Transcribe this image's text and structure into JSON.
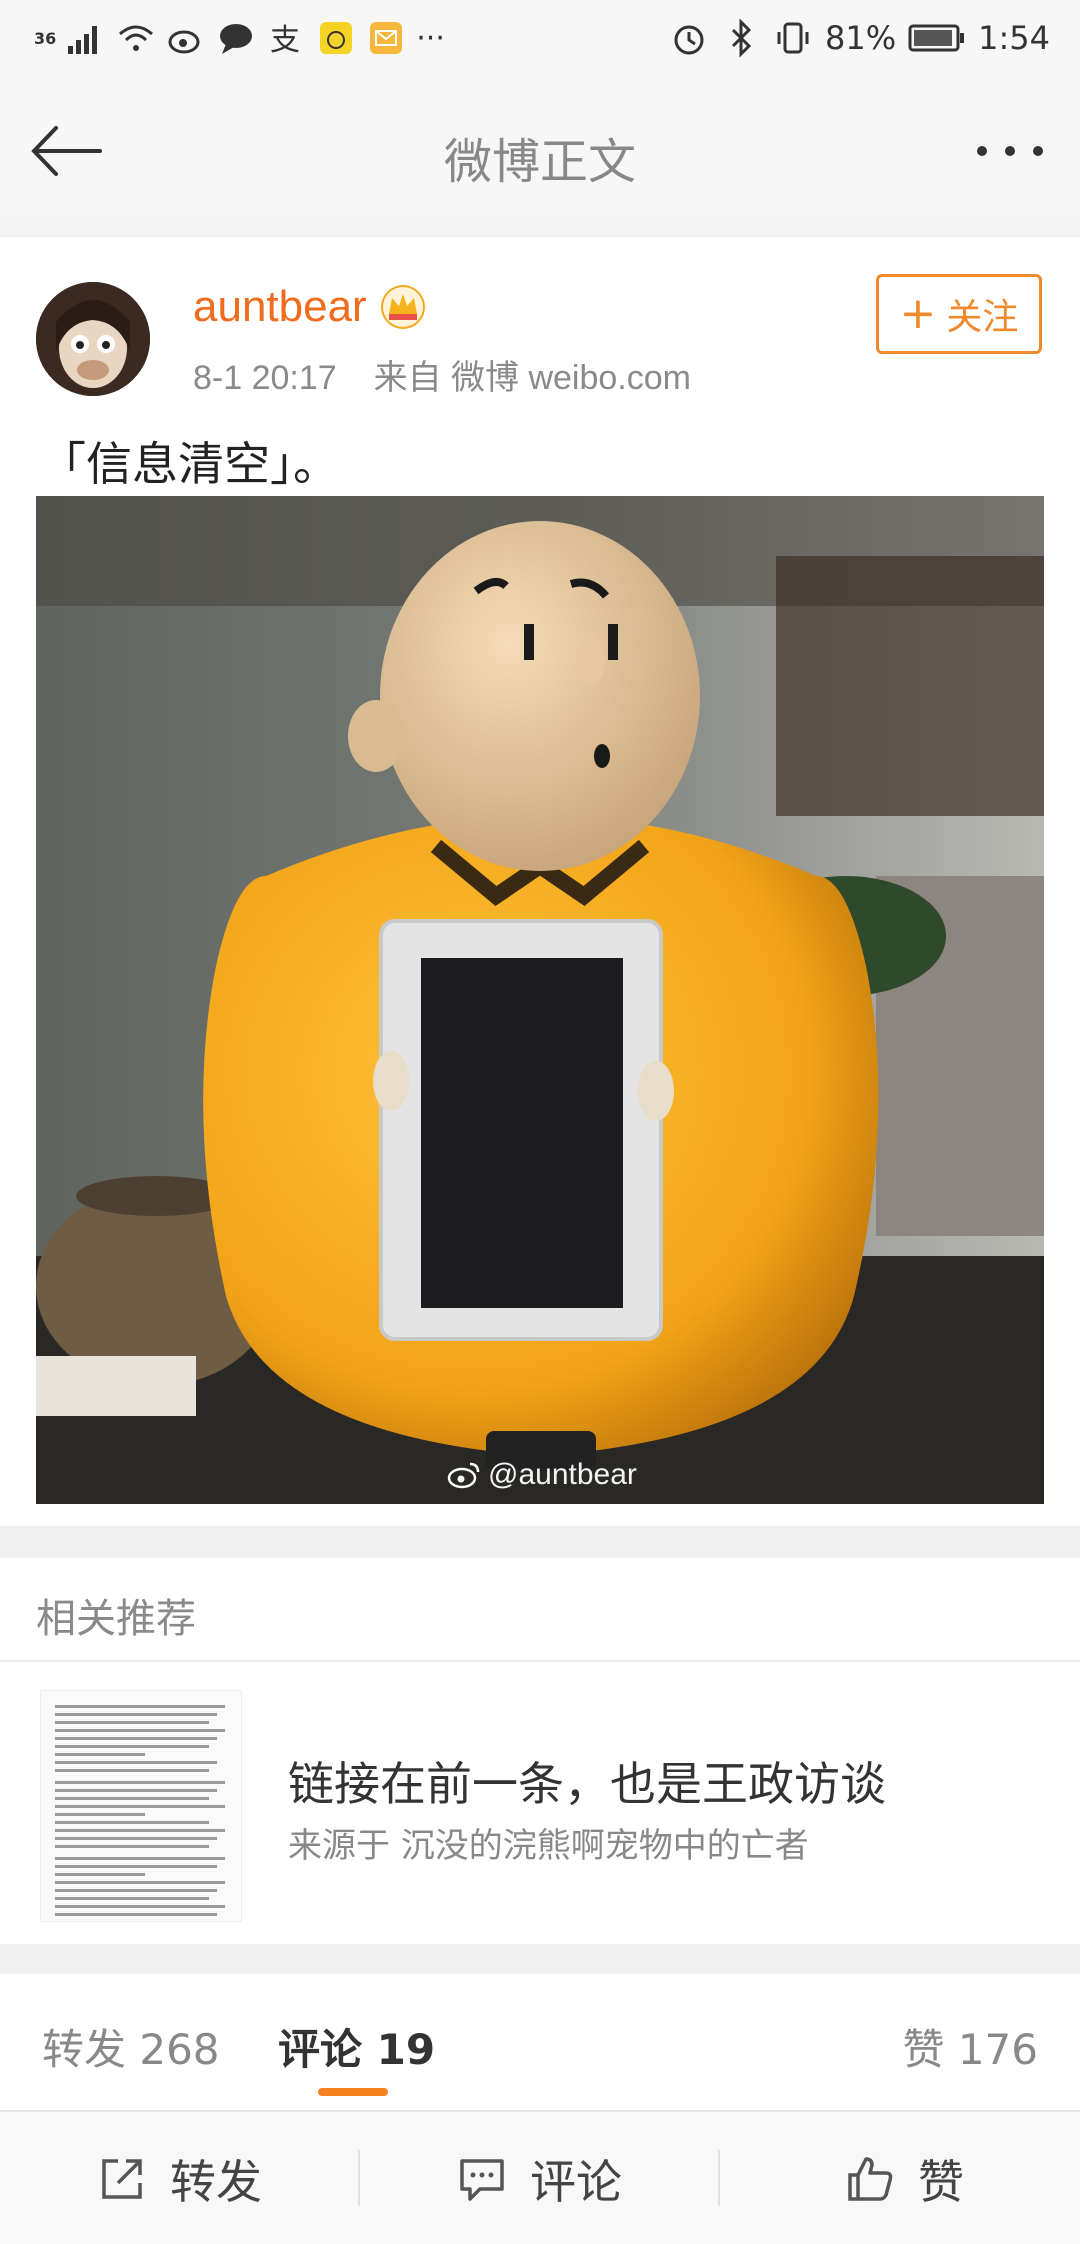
{
  "status_bar": {
    "network": "36",
    "battery": "81%",
    "time": "1:54",
    "more": "···"
  },
  "nav": {
    "title": "微博正文"
  },
  "post": {
    "username": "auntbear",
    "time": "8-1 20:17",
    "source": "来自 微博 weibo.com",
    "follow_label": "关注",
    "follow_plus": "+",
    "text": "「信息清空」。",
    "watermark": "@auntbear"
  },
  "related": {
    "section_title": "相关推荐",
    "headline": "链接在前一条，也是王政访谈",
    "source": "来源于 沉没的浣熊啊宠物中的亡者"
  },
  "tabs": {
    "repost": "转发 268",
    "comment": "评论 19",
    "like": "赞 176"
  },
  "bottom_bar": {
    "repost": "转发",
    "comment": "评论",
    "like": "赞"
  },
  "colors": {
    "accent": "#f06b1e",
    "tab_indicator": "#f5821f"
  }
}
